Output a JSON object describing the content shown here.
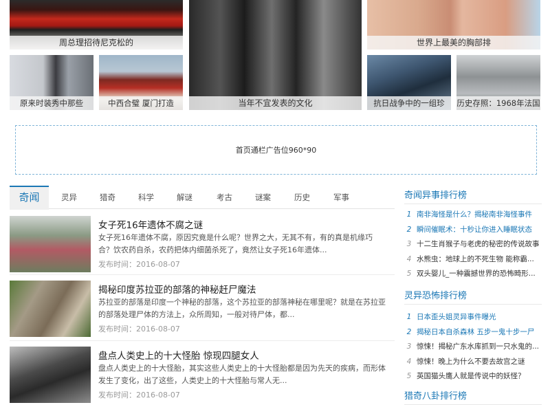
{
  "gallery": {
    "tiles": [
      {
        "caption": "周总理招待尼克松的"
      },
      {
        "caption": "世界上最美的胸部排"
      },
      {
        "caption": "原来时装秀中那些"
      },
      {
        "caption": "中西合璧 厦门打造"
      },
      {
        "caption": "当年不宜发表的文化"
      },
      {
        "caption": "抗日战争中的一组珍"
      },
      {
        "caption": "历史存照：1968年法国"
      }
    ]
  },
  "ad": {
    "text": "首页通栏广告位960*90"
  },
  "tabs": [
    "奇闻",
    "灵异",
    "猎奇",
    "科学",
    "解谜",
    "考古",
    "谜案",
    "历史",
    "军事"
  ],
  "articles": [
    {
      "title": "女子死16年遗体不腐之谜",
      "desc": "女子死16年遗体不腐，原因究竟是什么呢？世界之大，无其不有，有的真是机缘巧合？饮农药自杀，农药把体内细菌杀死了，竟然让女子死16年遗体...",
      "date": "发布时间：2016-08-07"
    },
    {
      "title": "揭秘印度苏拉亚的部落的神秘赶尸魔法",
      "desc": "苏拉亚的部落是印度一个神秘的部落，这个苏拉亚的部落神秘在哪里呢？就是在苏拉亚的部落处理尸体的方法上，众所周知，一般对待尸体，都...",
      "date": "发布时间：2016-08-07"
    },
    {
      "title": "盘点人类史上的十大怪胎 惊现四腿女人",
      "desc": "盘点人类史上的十大怪胎，其实这些人类史上的十大怪胎都是因为先天的疾病，而形体发生了变化，出了这些，人类史上的十大怪胎与常人无...",
      "date": "发布时间：2016-08-07"
    }
  ],
  "sidebar": {
    "sections": [
      {
        "title": "奇闻异事排行榜",
        "items": [
          {
            "num": "1",
            "text": "南非海怪是什么？揭秘南非海怪事件"
          },
          {
            "num": "2",
            "text": "瞬间催眠术：十秒让你进入睡眠状态"
          },
          {
            "num": "3",
            "text": "十二生肖猴子与老虎的秘密的传说故事"
          },
          {
            "num": "4",
            "text": "水熊虫：地球上的不死生物 能称霸..."
          },
          {
            "num": "5",
            "text": "双头婴儿_一种震撼世界的恐怖畸形..."
          }
        ]
      },
      {
        "title": "灵异恐怖排行榜",
        "items": [
          {
            "num": "1",
            "text": "日本歪头姐灵异事件曝光"
          },
          {
            "num": "2",
            "text": "揭秘日本自杀森林 五步一鬼十步一尸"
          },
          {
            "num": "3",
            "text": "惊悚！揭秘广东水库抓到一只水鬼的..."
          },
          {
            "num": "4",
            "text": "惊悚！晚上为什么不要去故宫之谜"
          },
          {
            "num": "5",
            "text": "英国猫头鹰人就是传说中的妖怪？"
          }
        ]
      },
      {
        "title": "猎奇八卦排行榜",
        "items": []
      }
    ]
  },
  "colors": {
    "accent": "#1a77b5",
    "ad_border": "#7fb4d8"
  }
}
